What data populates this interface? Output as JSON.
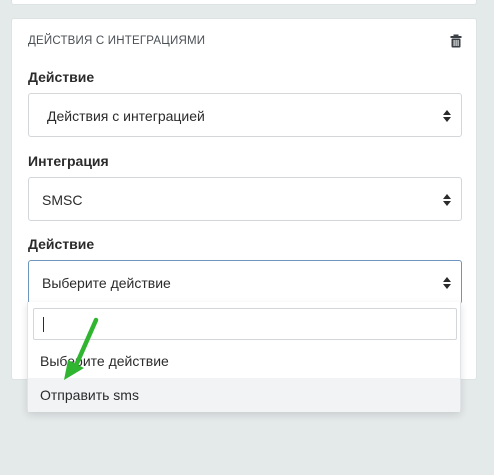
{
  "panel": {
    "title": "ДЕЙСТВИЯ С ИНТЕГРАЦИЯМИ",
    "delete_icon": "trash-icon"
  },
  "fields": {
    "action": {
      "label": "Действие",
      "value": "Действия с интеграцией"
    },
    "integration": {
      "label": "Интеграция",
      "value": "SMSC"
    },
    "integration_action": {
      "label": "Действие",
      "value": "Выберите действие"
    }
  },
  "dropdown": {
    "search_value": "",
    "options": [
      {
        "label": "Выберите действие"
      },
      {
        "label": "Отправить sms"
      }
    ]
  },
  "colors": {
    "background": "#e4e9ea",
    "focus_border": "#6e95bf",
    "annotation_arrow": "#2fb52f"
  }
}
